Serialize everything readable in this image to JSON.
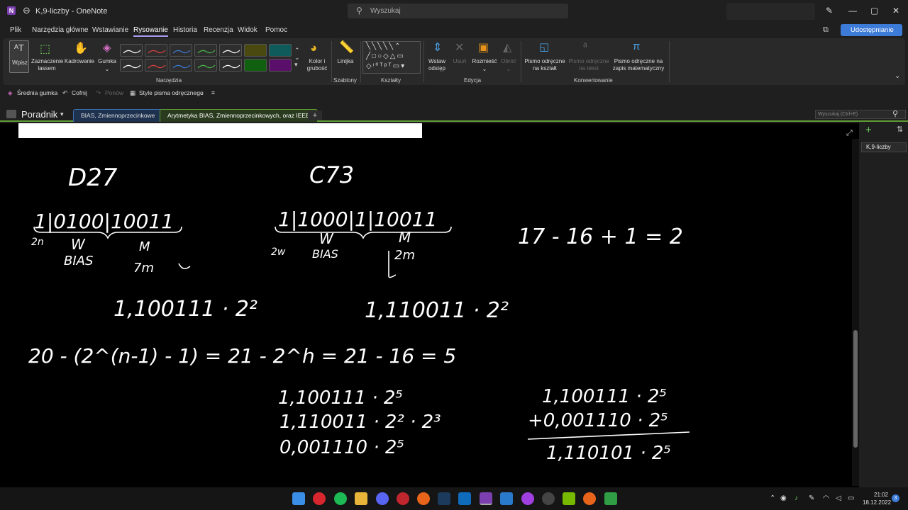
{
  "window": {
    "title": "K,9-liczby - OneNote",
    "app_icon": "N"
  },
  "search": {
    "placeholder": "Wyszukaj"
  },
  "menu": {
    "items": [
      "Plik",
      "Narzędzia główne",
      "Wstawianie",
      "Rysowanie",
      "Historia",
      "Recenzja",
      "Widok",
      "Pomoc"
    ],
    "active": "Rysowanie",
    "share_label": "Udostępnianie"
  },
  "ribbon": {
    "tools": {
      "type": "Wpisz",
      "lasso": "Zaznaczenie lassem",
      "pan": "Kadrowanie",
      "eraser": "Gumka",
      "color": "Kolor i grubość",
      "group": "Narzędzia"
    },
    "stencils": {
      "ruler": "Linijka",
      "group": "Szablony"
    },
    "shapes": {
      "group": "Kształty"
    },
    "edit": {
      "insert_space": "Wstaw odstęp",
      "delete": "Usuń",
      "arrange": "Rozmieść",
      "rotate": "Obróć",
      "group": "Edycja"
    },
    "convert": {
      "ink_to_shape": "Pismo odręczne na kształt",
      "ink_to_text": "Pismo odręczne na tekst",
      "ink_to_math": "Pismo odręczne na zapis matematyczny",
      "group": "Konwertowanie"
    }
  },
  "quickbar": {
    "eraser": "Średnia gumka",
    "undo": "Cofnij",
    "redo": "Ponów",
    "ink_styles": "Style pisma odręcznego"
  },
  "notebook": {
    "name": "Poradnik",
    "tabs": [
      "BIAS, Zmiennoprzecinkowe",
      "Arytmetyka BIAS, Zmiennoprzecinkowych, oraz IEEE"
    ],
    "active_tab": 1,
    "search_placeholder": "Wyszukaj (Ctrl+E)"
  },
  "pages": {
    "items": [
      "K,9-liczby"
    ]
  },
  "canvas": {
    "notes": [
      "D27",
      "C73",
      "1|0100|10011",
      "W",
      "2n",
      "BIAS",
      "M",
      "7m",
      "1|1000|1|10011",
      "W",
      "2w",
      "BIAS",
      "M",
      "2m",
      "17 - 16 + 1 = 2",
      "1,100111 · 2²",
      "1,110011 · 2²",
      "20 - (2^(n-1) - 1) = 21 - 2^h = 21 - 16 = 5",
      "1,100111 · 2⁵",
      "1,110011 · 2² · 2³",
      "0,001110 · 2⁵",
      "1,100111 · 2⁵",
      "+0,001110 · 2⁵",
      "1,110101 · 2⁵"
    ]
  },
  "taskbar": {
    "time": "21:02",
    "date": "18.12.2022",
    "notification_count": "3"
  },
  "colors": {
    "accent": "#3d7bd9",
    "onenote_purple": "#7b3fb0",
    "section_green": "#5f9b34",
    "ink": "#ffffff"
  }
}
